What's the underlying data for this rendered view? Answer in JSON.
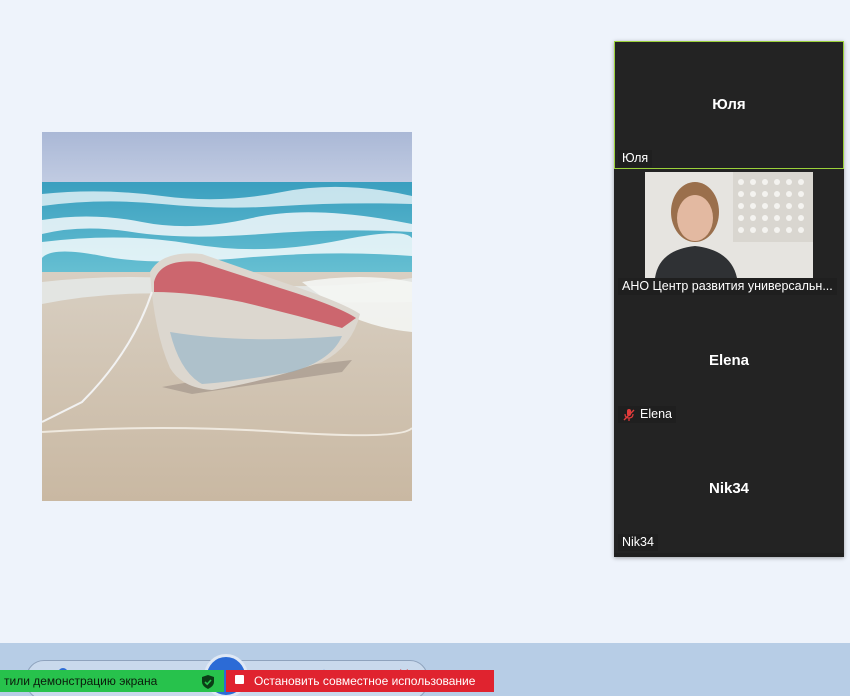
{
  "participants": [
    {
      "display": "Юля",
      "label": "Юля",
      "muted": false,
      "active": true,
      "video": false
    },
    {
      "label": "АНО Центр развития универсальн...",
      "muted": false,
      "active": false,
      "video": true
    },
    {
      "display": "Elena",
      "label": "Elena",
      "muted": true,
      "active": false,
      "video": false
    },
    {
      "display": "Nik34",
      "label": "Nik34",
      "muted": false,
      "active": false,
      "video": false
    }
  ],
  "share_bar": {
    "sharing_text": "тили демонстрацию экрана",
    "stop_label": "Остановить совместное использование"
  },
  "colors": {
    "active_border": "#9bd13a",
    "share_green": "#27c24c",
    "stop_red": "#e0232f"
  },
  "icons": [
    "mic-muted-icon",
    "shield-check-icon",
    "stop-square-icon"
  ]
}
